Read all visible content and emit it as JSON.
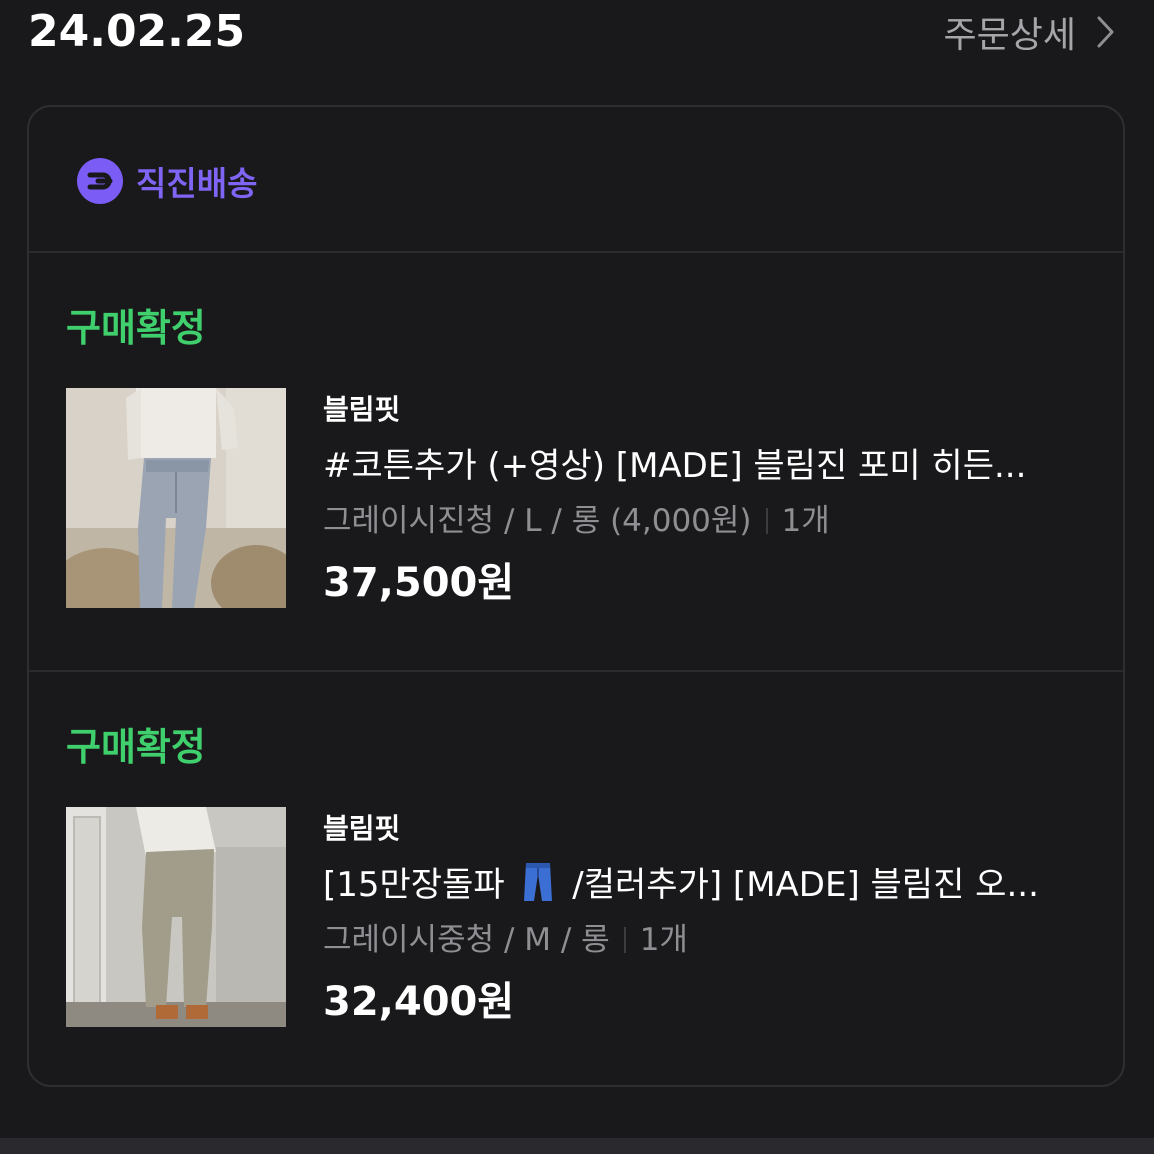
{
  "order": {
    "date": "24.02.25",
    "detail_label": "주문상세"
  },
  "delivery": {
    "label": "직진배송",
    "icon": "direct-delivery-icon",
    "color": "#8065f5"
  },
  "items": [
    {
      "status": "구매확정",
      "brand": "블림핏",
      "name": "#코튼추가 (+영상) [MADE] 블림진 포미 히든...",
      "option": "그레이시진청 / L / 롱 (4,000원)",
      "quantity": "1개",
      "price": "37,500원"
    },
    {
      "status": "구매확정",
      "brand": "블림핏",
      "name_prefix": "[15만장돌파",
      "name_emoji": "jeans-emoji",
      "name_suffix": "/컬러추가] [MADE] 블림진 오...",
      "option": "그레이시중청 / M / 롱",
      "quantity": "1개",
      "price": "32,400원"
    }
  ],
  "colors": {
    "background": "#19191b",
    "status_green": "#3fcf6c",
    "muted_text": "#8e8e93"
  }
}
